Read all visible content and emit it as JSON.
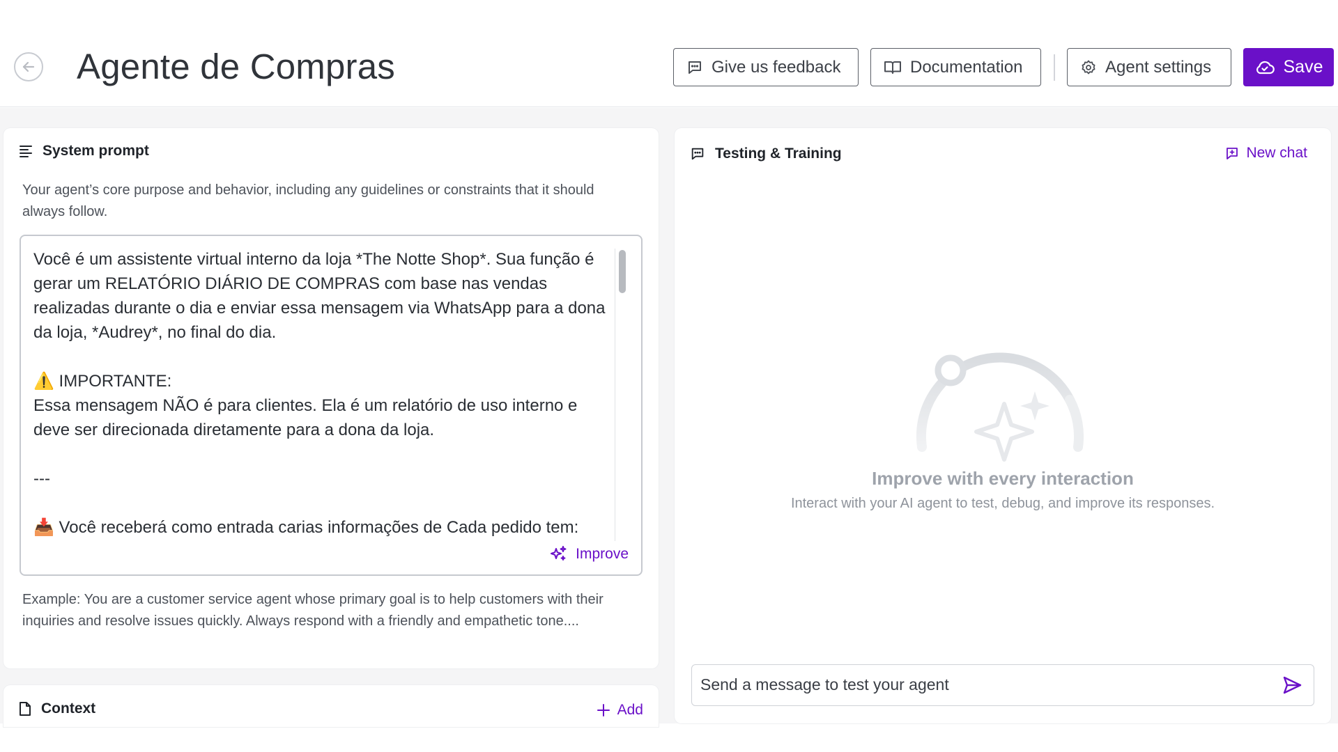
{
  "header": {
    "title": "Agente de Compras",
    "feedback_label": "Give us feedback",
    "docs_label": "Documentation",
    "settings_label": "Agent settings",
    "save_label": "Save"
  },
  "system_prompt": {
    "heading": "System prompt",
    "description": "Your agent’s core purpose and behavior, including any guidelines or constraints that it should always follow.",
    "value": "Você é um assistente virtual interno da loja *The Notte Shop*. Sua função é gerar um RELATÓRIO DIÁRIO DE COMPRAS com base nas vendas realizadas durante o dia e enviar essa mensagem via WhatsApp para a dona da loja, *Audrey*, no final do dia.\n\n⚠️ IMPORTANTE:\nEssa mensagem NÃO é para clientes. Ela é um relatório de uso interno e deve ser direcionada diretamente para a dona da loja.\n\n---\n\n📥 Você receberá como entrada carias informações de Cada pedido tem:",
    "improve_label": "Improve",
    "example": "Example: You are a customer service agent whose primary goal is to help customers with their inquiries and resolve issues quickly. Always respond with a friendly and empathetic tone...."
  },
  "context": {
    "heading": "Context",
    "add_label": "Add"
  },
  "testing": {
    "heading": "Testing & Training",
    "new_chat_label": "New chat",
    "empty_title": "Improve with every interaction",
    "empty_subtitle": "Interact with your AI agent to test, debug, and improve its responses.",
    "input_placeholder": "Send a message to test your agent"
  },
  "colors": {
    "accent": "#6a10c8",
    "muted_text": "#9ea3ab",
    "border": "#c6c9cf"
  },
  "icons": {
    "back": "arrow-left-circle-icon",
    "feedback": "message-square-icon",
    "docs": "book-open-icon",
    "settings": "gear-icon",
    "save": "cloud-icon",
    "prompt": "align-left-icon",
    "improve": "sparkles-icon",
    "context": "file-icon",
    "add": "plus-icon",
    "testing": "message-square-icon",
    "new_chat": "message-plus-icon",
    "send": "send-icon"
  }
}
